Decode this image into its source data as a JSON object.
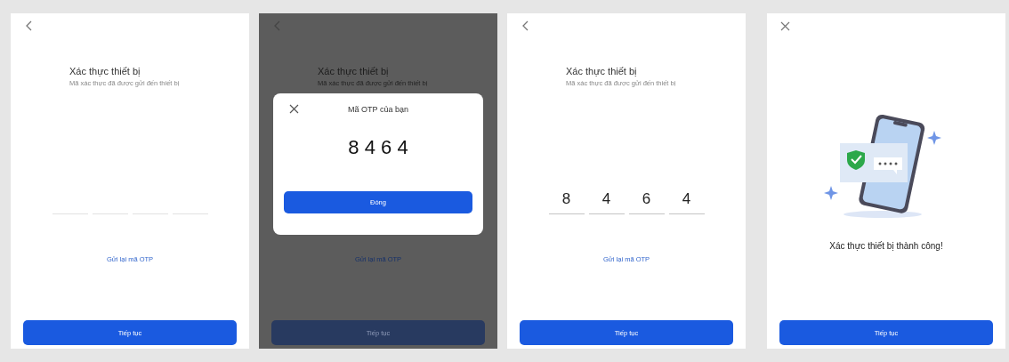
{
  "screens": [
    {
      "kind": "entry",
      "dimmed": false,
      "title": "Xác thực thiết bị",
      "subtitle": "Mã xác thực đã được gửi đến thiết bị",
      "otp_slots": [
        {
          "filled": false
        },
        {
          "filled": false
        },
        {
          "filled": false
        },
        {
          "filled": false
        }
      ],
      "resend_link": "Gửi lại mã OTP",
      "button": "Tiếp tục"
    },
    {
      "kind": "entry",
      "dimmed": true,
      "title": "Xác thực thiết bị",
      "subtitle": "Mã xác thực đã được gửi đến thiết bị",
      "resend_link": "Gửi lại mã OTP",
      "button": "Tiếp tục",
      "modal": {
        "title": "Mã OTP của bạn",
        "code": "8 4 6 4",
        "button": "Đóng"
      }
    },
    {
      "kind": "entry",
      "dimmed": false,
      "title": "Xác thực thiết bị",
      "subtitle": "Mã xác thực đã được gửi đến thiết bị",
      "otp_slots": [
        {
          "filled": true,
          "digit": "8"
        },
        {
          "filled": true,
          "digit": "4"
        },
        {
          "filled": true,
          "digit": "6"
        },
        {
          "filled": true,
          "digit": "4"
        }
      ],
      "resend_link": "Gửi lại mã OTP",
      "button": "Tiếp tục"
    },
    {
      "kind": "success",
      "message": "Xác thực thiết bị thành công!",
      "button": "Tiếp tục"
    }
  ]
}
